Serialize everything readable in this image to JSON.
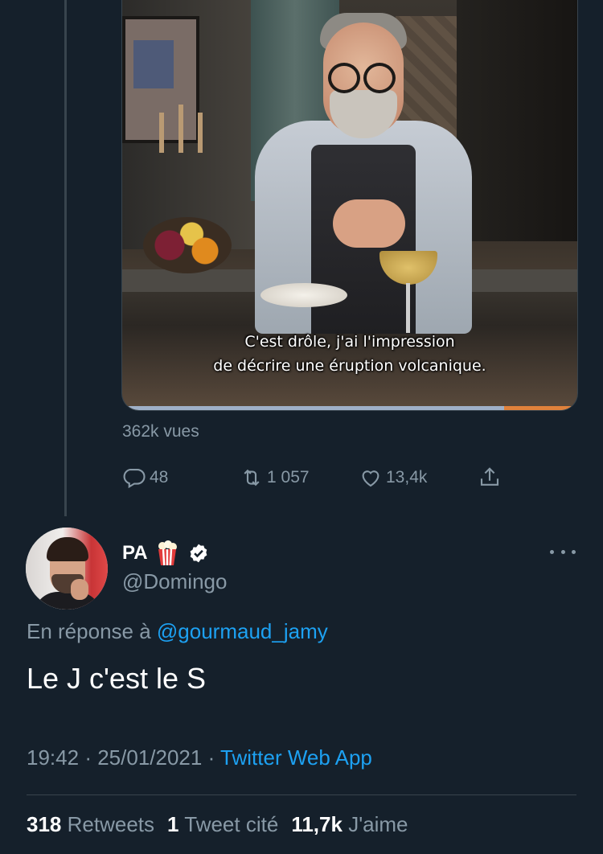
{
  "quoted_tweet": {
    "video": {
      "subtitle_line1": "C'est drôle, j'ai l'impression",
      "subtitle_line2": "de décrire une éruption volcanique.",
      "progress_fraction": 0.84
    },
    "views": "362k vues",
    "actions": {
      "replies": "48",
      "retweets": "1 057",
      "likes": "13,4k"
    }
  },
  "tweet": {
    "author_name": "PA",
    "author_emoji_icon": "popcorn-icon",
    "verified_icon": "verified-badge-icon",
    "handle": "@Domingo",
    "reply_prefix": "En réponse à",
    "reply_handle": "@gourmaud_jamy",
    "text": "Le J c'est le S",
    "time": "19:42",
    "separator": "·",
    "date": "25/01/2021",
    "source": "Twitter Web App"
  },
  "stats": {
    "retweets_count": "318",
    "retweets_label": "Retweets",
    "quotes_count": "1",
    "quotes_label": "Tweet cité",
    "likes_count": "11,7k",
    "likes_label": "J'aime"
  },
  "colors": {
    "background": "#15202b",
    "secondary_text": "#8899a6",
    "link": "#1da1f2",
    "divider": "#38444d"
  }
}
